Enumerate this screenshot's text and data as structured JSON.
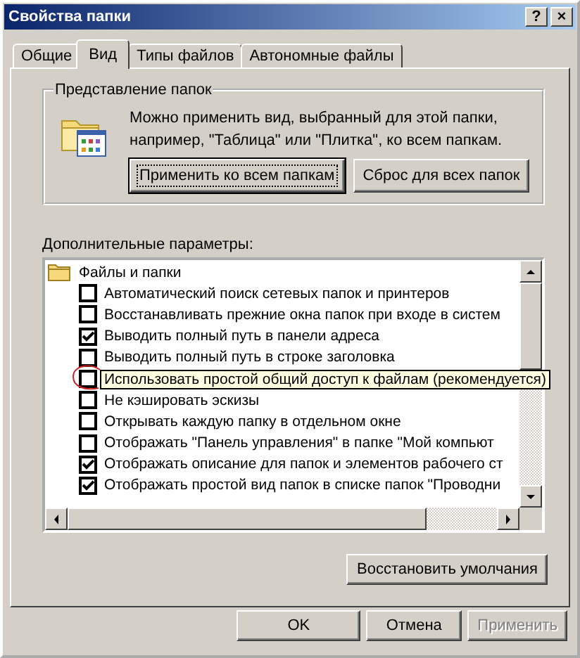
{
  "window": {
    "title": "Свойства папки",
    "help_button": "?",
    "close_button": "×"
  },
  "tabs": [
    {
      "label": "Общие",
      "selected": false
    },
    {
      "label": "Вид",
      "selected": true
    },
    {
      "label": "Типы файлов",
      "selected": false
    },
    {
      "label": "Автономные файлы",
      "selected": false
    }
  ],
  "folder_views": {
    "title": "Представление папок",
    "description": "Можно применить вид, выбранный для этой папки, например, \"Таблица\" или \"Плитка\", ко всем папкам.",
    "buttons": [
      {
        "label": "Применить ко всем папкам",
        "focused": true
      },
      {
        "label": "Сброс для всех папок",
        "focused": false
      }
    ]
  },
  "advanced": {
    "label": "Дополнительные параметры:",
    "group": "Файлы и папки",
    "items": [
      {
        "label": "Автоматический поиск сетевых папок и принтеров",
        "checked": false,
        "tooltip": false
      },
      {
        "label": "Восстанавливать прежние окна папок при входе в систем",
        "checked": false,
        "tooltip": false
      },
      {
        "label": "Выводить полный путь в панели адреса",
        "checked": true,
        "tooltip": false
      },
      {
        "label": "Выводить полный путь в строке заголовка",
        "checked": false,
        "tooltip": false
      },
      {
        "label": "Использовать простой общий доступ к файлам (рекомендуется)",
        "checked": false,
        "tooltip": true
      },
      {
        "label": "Не кэшировать эскизы",
        "checked": false,
        "tooltip": false
      },
      {
        "label": "Открывать каждую папку в отдельном окне",
        "checked": false,
        "tooltip": false
      },
      {
        "label": "Отображать \"Панель управления\" в папке \"Мой компьют",
        "checked": false,
        "tooltip": false
      },
      {
        "label": "Отображать описание для папок и элементов рабочего ст",
        "checked": true,
        "tooltip": false
      },
      {
        "label": "Отображать простой вид папок в списке папок \"Проводни",
        "checked": true,
        "tooltip": false
      }
    ],
    "restore_button": "Восстановить умолчания"
  },
  "buttons": [
    {
      "label": "OK",
      "disabled": false
    },
    {
      "label": "Отмена",
      "disabled": false
    },
    {
      "label": "Применить",
      "disabled": true
    }
  ]
}
